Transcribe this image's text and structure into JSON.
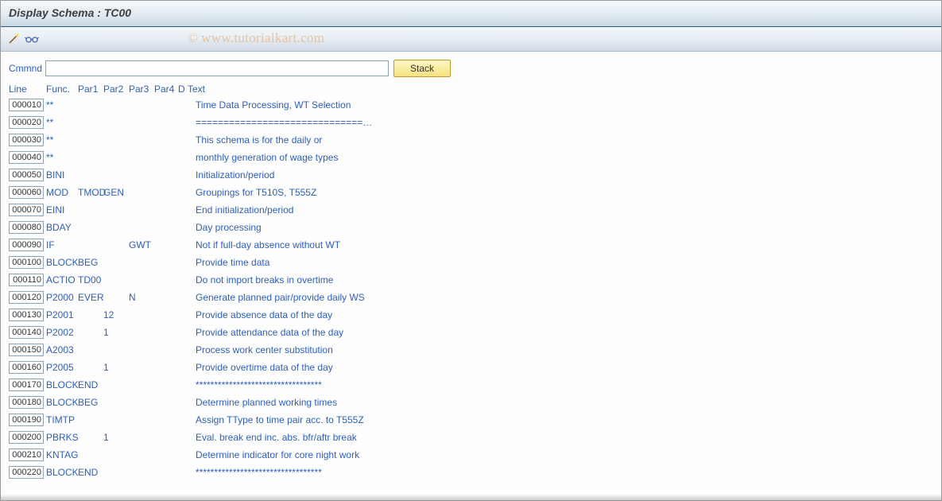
{
  "title": "Display Schema : TC00",
  "watermark": "www.tutorialkart.com",
  "command": {
    "label": "Cmmnd",
    "value": "",
    "stackLabel": "Stack"
  },
  "columns": {
    "line": "Line",
    "func": "Func.",
    "par1": "Par1",
    "par2": "Par2",
    "par3": "Par3",
    "par4": "Par4",
    "d": "D",
    "text": "Text"
  },
  "rows": [
    {
      "line": "000010",
      "func": "**",
      "par1": "",
      "par2": "",
      "par3": "",
      "par4": "",
      "d": "",
      "text": "Time Data Processing, WT Selection"
    },
    {
      "line": "000020",
      "func": "**",
      "par1": "",
      "par2": "",
      "par3": "",
      "par4": "",
      "d": "",
      "text": "==============================…"
    },
    {
      "line": "000030",
      "func": "**",
      "par1": "",
      "par2": "",
      "par3": "",
      "par4": "",
      "d": "",
      "text": "This schema is for the daily or"
    },
    {
      "line": "000040",
      "func": "**",
      "par1": "",
      "par2": "",
      "par3": "",
      "par4": "",
      "d": "",
      "text": "monthly generation of wage types"
    },
    {
      "line": "000050",
      "func": "BINI",
      "par1": "",
      "par2": "",
      "par3": "",
      "par4": "",
      "d": "",
      "text": "Initialization/period"
    },
    {
      "line": "000060",
      "func": "MOD",
      "par1": "TMOD",
      "par2": "GEN",
      "par3": "",
      "par4": "",
      "d": "",
      "text": "Groupings for T510S, T555Z"
    },
    {
      "line": "000070",
      "func": "EINI",
      "par1": "",
      "par2": "",
      "par3": "",
      "par4": "",
      "d": "",
      "text": "End initialization/period"
    },
    {
      "line": "000080",
      "func": "BDAY",
      "par1": "",
      "par2": "",
      "par3": "",
      "par4": "",
      "d": "",
      "text": "Day processing"
    },
    {
      "line": "000090",
      "func": "IF",
      "par1": "",
      "par2": "",
      "par3": "GWT",
      "par4": "",
      "d": "",
      "text": "Not if full-day absence without WT"
    },
    {
      "line": "000100",
      "func": "BLOCK",
      "par1": "BEG",
      "par2": "",
      "par3": "",
      "par4": "",
      "d": "",
      "text": "Provide time data"
    },
    {
      "line": "000110",
      "func": "ACTIO",
      "par1": "TD00",
      "par2": "",
      "par3": "",
      "par4": "",
      "d": "",
      "text": "Do not import breaks in overtime"
    },
    {
      "line": "000120",
      "func": "P2000",
      "par1": "EVER",
      "par2": "",
      "par3": "N",
      "par4": "",
      "d": "",
      "text": "Generate planned pair/provide daily WS"
    },
    {
      "line": "000130",
      "func": "P2001",
      "par1": "",
      "par2": "12",
      "par3": "",
      "par4": "",
      "d": "",
      "text": "Provide absence data of the day"
    },
    {
      "line": "000140",
      "func": "P2002",
      "par1": "",
      "par2": "1",
      "par3": "",
      "par4": "",
      "d": "",
      "text": "Provide attendance data of the day"
    },
    {
      "line": "000150",
      "func": "A2003",
      "par1": "",
      "par2": "",
      "par3": "",
      "par4": "",
      "d": "",
      "text": "Process work center substitution"
    },
    {
      "line": "000160",
      "func": "P2005",
      "par1": "",
      "par2": "1",
      "par3": "",
      "par4": "",
      "d": "",
      "text": "Provide overtime data of the day"
    },
    {
      "line": "000170",
      "func": "BLOCK",
      "par1": "END",
      "par2": "",
      "par3": "",
      "par4": "",
      "d": "",
      "text": "**********************************"
    },
    {
      "line": "000180",
      "func": "BLOCK",
      "par1": "BEG",
      "par2": "",
      "par3": "",
      "par4": "",
      "d": "",
      "text": "Determine planned working times"
    },
    {
      "line": "000190",
      "func": "TIMTP",
      "par1": "",
      "par2": "",
      "par3": "",
      "par4": "",
      "d": "",
      "text": "Assign TType to time pair acc. to T555Z"
    },
    {
      "line": "000200",
      "func": "PBRKS",
      "par1": "",
      "par2": "1",
      "par3": "",
      "par4": "",
      "d": "",
      "text": "Eval. break end inc. abs. bfr/aftr break"
    },
    {
      "line": "000210",
      "func": "KNTAG",
      "par1": "",
      "par2": "",
      "par3": "",
      "par4": "",
      "d": "",
      "text": "Determine indicator for core night work"
    },
    {
      "line": "000220",
      "func": "BLOCK",
      "par1": "END",
      "par2": "",
      "par3": "",
      "par4": "",
      "d": "",
      "text": "**********************************"
    }
  ]
}
